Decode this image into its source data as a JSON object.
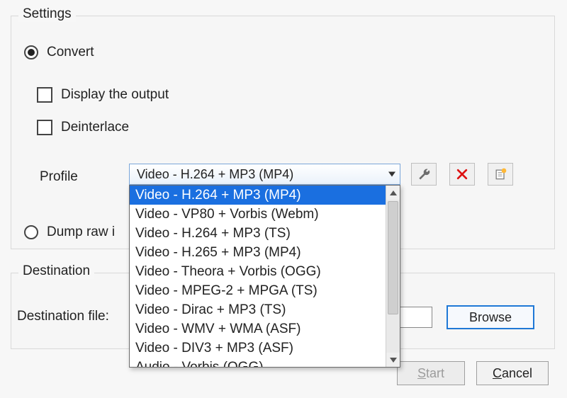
{
  "settings": {
    "legend": "Settings",
    "convert": {
      "label": "Convert",
      "checked": true
    },
    "display_output": {
      "label": "Display the output",
      "checked": false
    },
    "deinterlace": {
      "label": "Deinterlace",
      "checked": false
    },
    "profile_label": "Profile",
    "profile_selected": "Video - H.264 + MP3 (MP4)",
    "profile_options": [
      "Video - H.264 + MP3 (MP4)",
      "Video - VP80 + Vorbis (Webm)",
      "Video - H.264 + MP3 (TS)",
      "Video - H.265 + MP3 (MP4)",
      "Video - Theora + Vorbis (OGG)",
      "Video - MPEG-2 + MPGA (TS)",
      "Video - Dirac + MP3 (TS)",
      "Video - WMV + WMA (ASF)",
      "Video - DIV3 + MP3 (ASF)",
      "Audio - Vorbis (OGG)"
    ],
    "dump_raw": {
      "label": "Dump raw input",
      "checked": false
    }
  },
  "destination": {
    "legend": "Destination",
    "file_label": "Destination file:",
    "file_value": "",
    "browse_label": "Browse"
  },
  "buttons": {
    "start": "Start",
    "cancel": "Cancel"
  },
  "icons": {
    "edit_profile": "wrench-icon",
    "delete_profile": "x-icon",
    "new_profile": "new-file-icon"
  }
}
